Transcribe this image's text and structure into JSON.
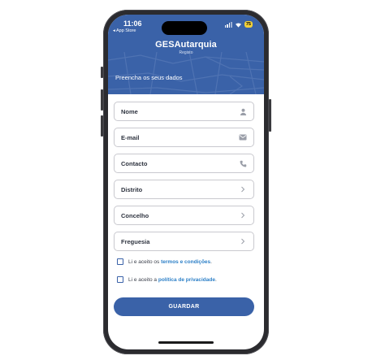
{
  "status_bar": {
    "time": "11:06",
    "back_app": "◂ App Store",
    "battery": "75"
  },
  "header": {
    "title": "GESAutarquia",
    "subtitle": "Registo",
    "instruction": "Preencha os seus dados"
  },
  "form": {
    "fields": [
      {
        "label": "Nome",
        "icon": "person-icon"
      },
      {
        "label": "E-mail",
        "icon": "mail-icon"
      },
      {
        "label": "Contacto",
        "icon": "phone-icon"
      },
      {
        "label": "Distrito",
        "icon": "chevron-right-icon"
      },
      {
        "label": "Concelho",
        "icon": "chevron-right-icon"
      },
      {
        "label": "Freguesia",
        "icon": "chevron-right-icon"
      }
    ],
    "terms_prefix": "Li e aceito os ",
    "terms_link": "termos e condições",
    "terms_suffix": ".",
    "privacy_prefix": "Li e aceito a ",
    "privacy_link": "política de privacidade",
    "privacy_suffix": ".",
    "save_label": "GUARDAR"
  },
  "colors": {
    "primary": "#3a62a8",
    "link": "#2c7fc7",
    "battery": "#f2d13a"
  }
}
